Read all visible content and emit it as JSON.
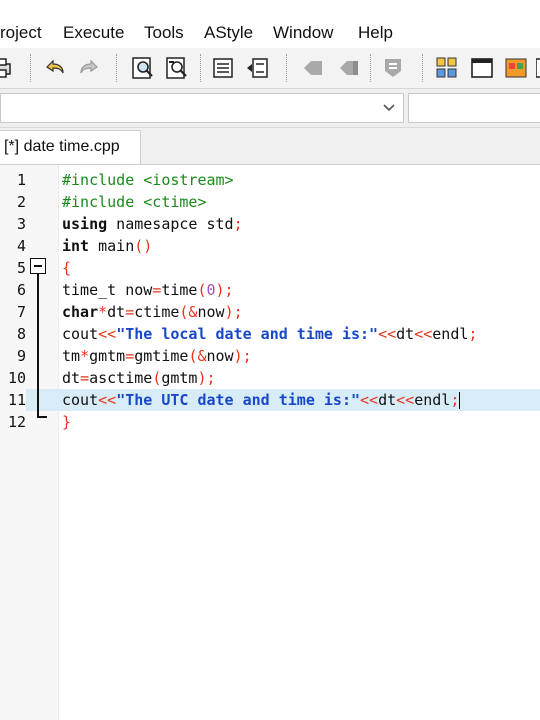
{
  "menu": {
    "items": [
      "roject",
      "Execute",
      "Tools",
      "AStyle",
      "Window",
      "Help"
    ]
  },
  "toolbar": {
    "icons": [
      "print-icon",
      "undo-icon",
      "redo-icon",
      "find-icon",
      "replace-icon",
      "indent-icon",
      "unindent-icon",
      "bookmark-prev-icon",
      "bookmark-next-icon",
      "toggle-comment-icon",
      "grid-view-icon",
      "window-icon",
      "color-icon"
    ]
  },
  "editor": {
    "tab_label": "[*] date time.cpp",
    "lines": [
      {
        "num": "1"
      },
      {
        "num": "2"
      },
      {
        "num": "3"
      },
      {
        "num": "4"
      },
      {
        "num": "5"
      },
      {
        "num": "6"
      },
      {
        "num": "7"
      },
      {
        "num": "8"
      },
      {
        "num": "9"
      },
      {
        "num": "10"
      },
      {
        "num": "11"
      },
      {
        "num": "12"
      }
    ],
    "code": {
      "l1": "#include <iostream>",
      "l2": "#include <ctime>",
      "l3_kw": "using",
      "l3_rest": " namesapce std",
      "l3_semi": ";",
      "l4_kw": "int",
      "l4_rest": " main",
      "l4_paren": "()",
      "l5": "{",
      "l6_a": "time_t now",
      "l6_eq": "=",
      "l6_b": "time",
      "l6_p1": "(",
      "l6_zero": "0",
      "l6_p2": ");",
      "l7_kw": "char",
      "l7_star": "*",
      "l7_a": "dt",
      "l7_eq": "=",
      "l7_b": "ctime",
      "l7_p1": "(&",
      "l7_c": "now",
      "l7_p2": ");",
      "l8_a": "cout",
      "l8_op": "<<",
      "l8_str": "\"The local date and time is:\"",
      "l8_op2": "<<",
      "l8_b": "dt",
      "l8_op3": "<<",
      "l8_c": "endl",
      "l8_semi": ";",
      "l9_a": "tm",
      "l9_star": "*",
      "l9_b": "gmtm",
      "l9_eq": "=",
      "l9_c": "gmtime",
      "l9_p1": "(&",
      "l9_d": "now",
      "l9_p2": ");",
      "l10_a": "dt",
      "l10_eq": "=",
      "l10_b": "asctime",
      "l10_p1": "(",
      "l10_c": "gmtm",
      "l10_p2": ");",
      "l11_a": "cout",
      "l11_op": "<<",
      "l11_str": "\"The UTC date and time is:\"",
      "l11_op2": "<<",
      "l11_b": "dt",
      "l11_op3": "<<",
      "l11_c": "endl",
      "l11_semi": ";",
      "l12": "}"
    }
  }
}
